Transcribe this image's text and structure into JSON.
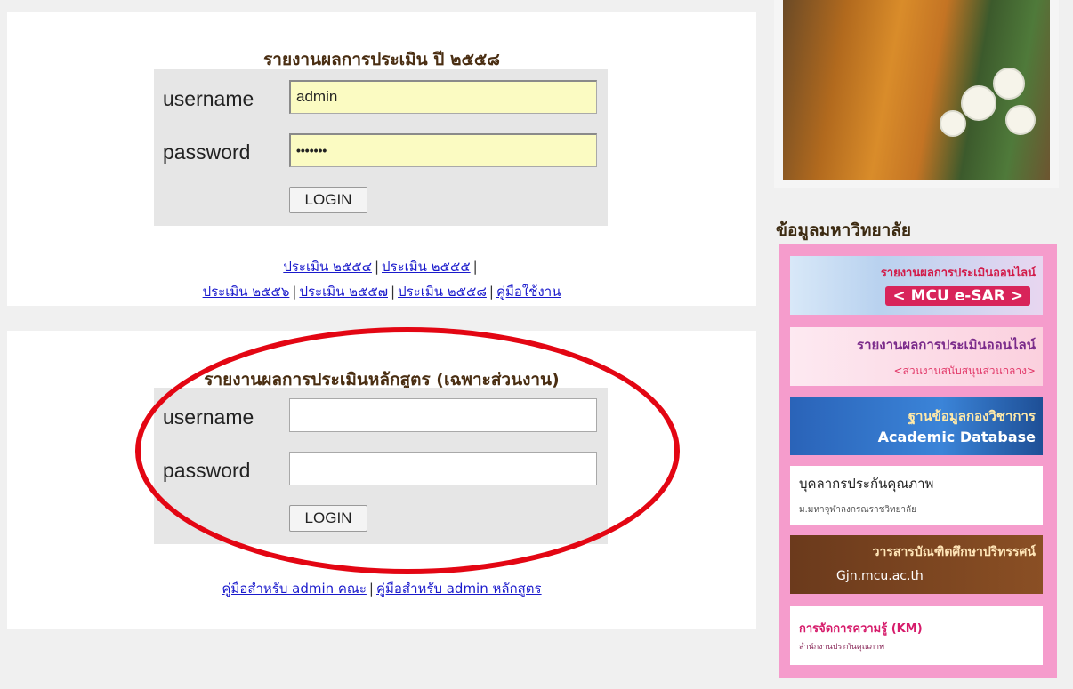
{
  "section1": {
    "title": "รายงานผลการประเมิน ปี ๒๕๕๘",
    "username_label": "username",
    "username_value": "admin",
    "password_label": "password",
    "password_value": "•••••••",
    "login_label": "LOGIN",
    "links_row1": [
      "ประเมิน ๒๕๕๔",
      "ประเมิน ๒๕๕๕"
    ],
    "links_row2": [
      "ประเมิน ๒๕๕๖",
      "ประเมิน ๒๕๕๗",
      "ประเมิน ๒๕๕๘",
      "คู่มือใช้งาน"
    ],
    "separator": "|"
  },
  "section2": {
    "title": "รายงานผลการประเมินหลักสูตร (เฉพาะส่วนงาน)",
    "username_label": "username",
    "username_value": "",
    "password_label": "password",
    "password_value": "",
    "login_label": "LOGIN",
    "links": [
      "คู่มือสำหรับ admin คณะ",
      "คู่มือสำหรับ admin หลักสูตร"
    ],
    "separator": "|"
  },
  "sidebar": {
    "heading": "ข้อมูลมหาวิทยาลัย",
    "banners": [
      {
        "line1": "รายงานผลการประเมินออนไลน์",
        "line2": "< MCU e-SAR >"
      },
      {
        "line1": "รายงานผลการประเมินออนไลน์",
        "line2": "<ส่วนงานสนับสนุนส่วนกลาง>"
      },
      {
        "line1": "ฐานข้อมูลกองวิชาการ",
        "line2": "Academic Database"
      },
      {
        "line1": "บุคลากรประกันคุณภาพ",
        "line2": "ม.มหาจุฬาลงกรณราชวิทยาลัย"
      },
      {
        "line1": "วารสารบัณฑิตศึกษาปริทรรศน์",
        "line2": "Gjn.mcu.ac.th"
      },
      {
        "line1": "การจัดการความรู้ (KM)",
        "line2": "สำนักงานประกันคุณภาพ"
      }
    ]
  },
  "colors": {
    "annotation": "#e30613",
    "sidebar_bg": "#f59ccc",
    "filled_input": "#fbfbc2"
  }
}
